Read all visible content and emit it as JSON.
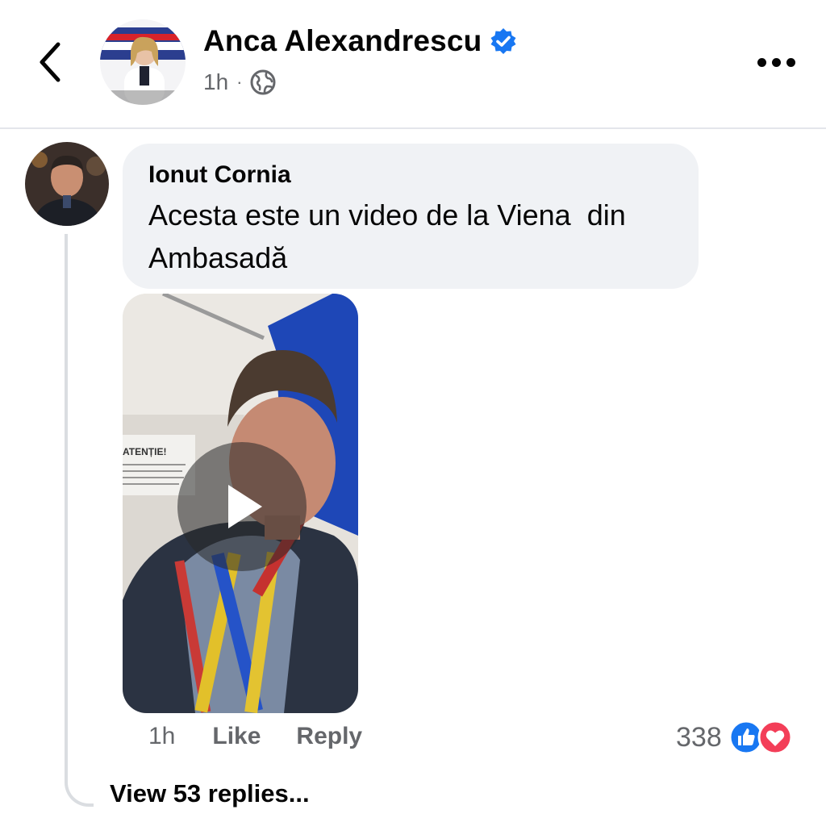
{
  "post_header": {
    "author_name": "Anca Alexandrescu",
    "time": "1h",
    "separator": "·",
    "verified_icon": "verified-badge-icon",
    "privacy_icon": "globe-icon",
    "back_icon": "chevron-left-icon",
    "more_icon": "more-dots-icon"
  },
  "comment": {
    "author": "Ionut Cornia",
    "text": "Acesta este un video de la Viena  din\nAmbasadă",
    "video_sign_text": "ATENȚIE!",
    "time": "1h",
    "like_label": "Like",
    "reply_label": "Reply",
    "reaction_count": "338",
    "reaction_icons": [
      "like-reaction-icon",
      "love-reaction-icon"
    ],
    "view_replies_label": "View 53 replies..."
  },
  "colors": {
    "verified_blue": "#1877f2",
    "like_blue": "#1877f2",
    "love_red": "#f33e58",
    "bubble_bg": "#f0f2f5",
    "secondary_text": "#65676b"
  }
}
